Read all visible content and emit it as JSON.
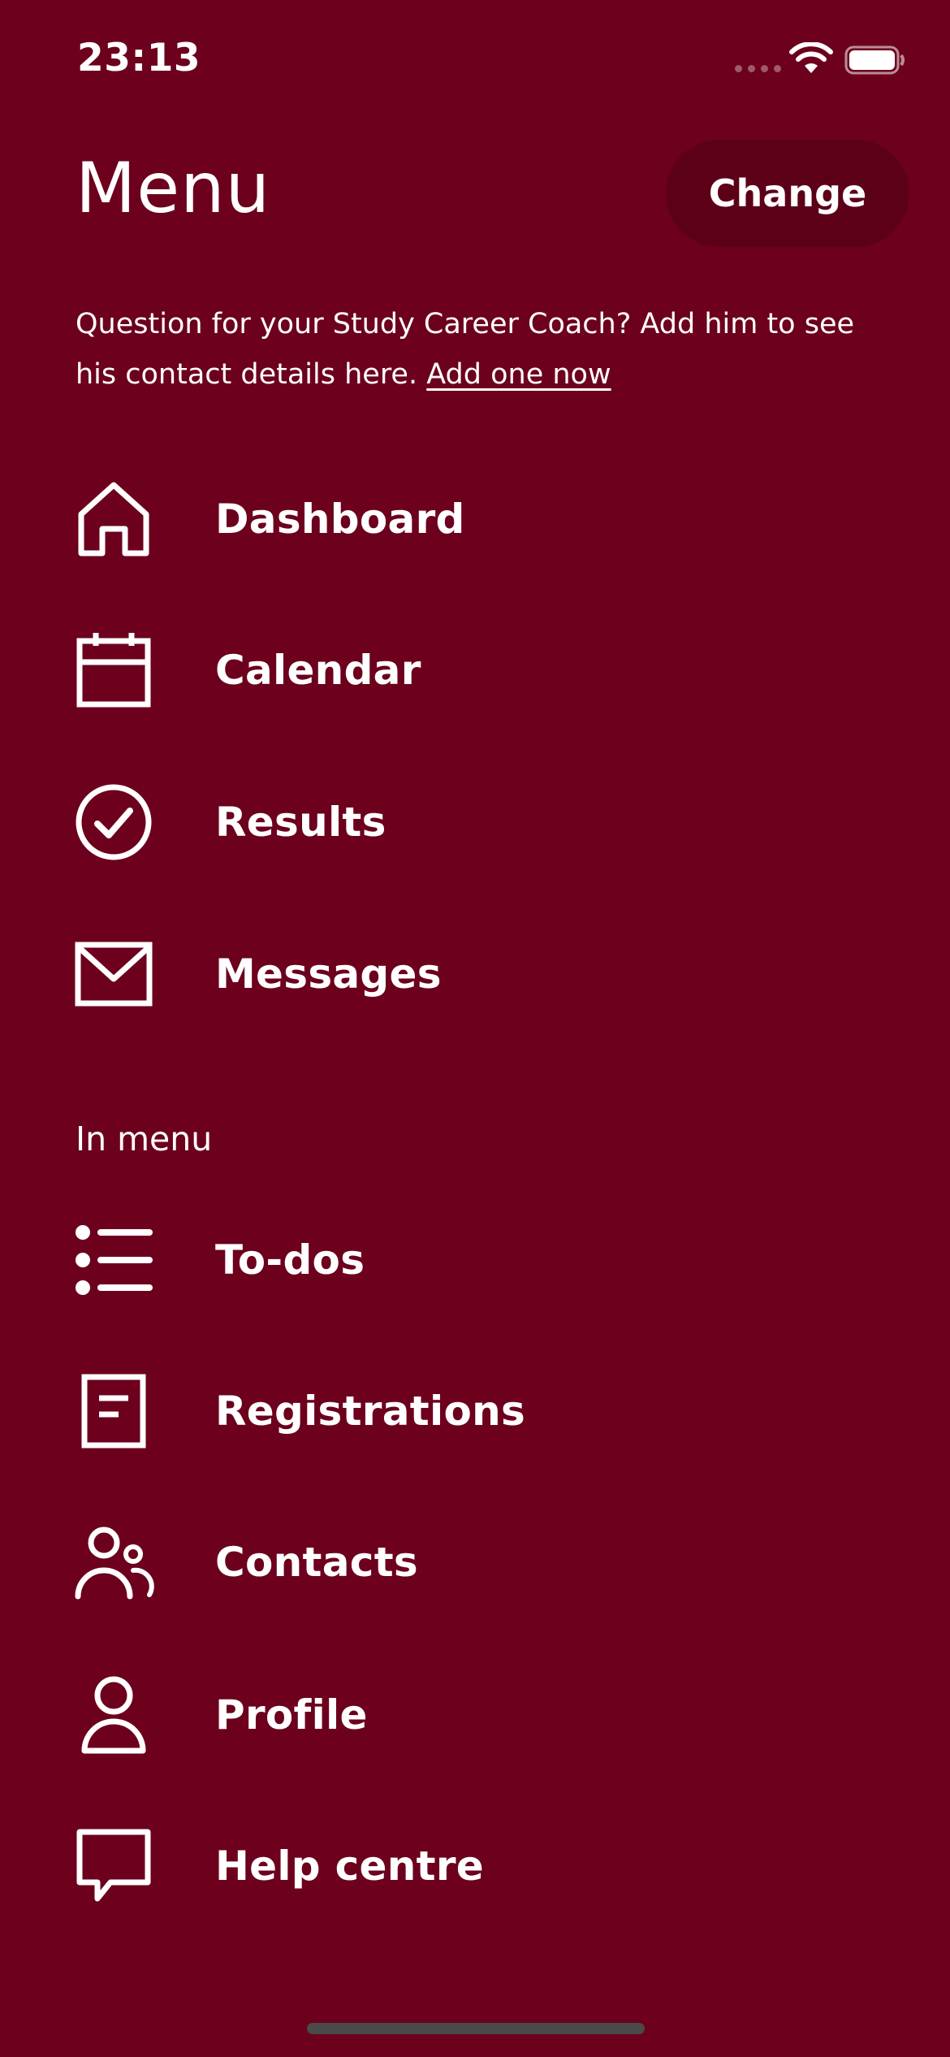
{
  "status_bar": {
    "time": "23:13",
    "wifi_icon": "wifi-icon",
    "battery_icon": "battery-icon"
  },
  "header": {
    "title": "Menu",
    "change_label": "Change"
  },
  "coach_notice": {
    "text": "Question for your Study Career Coach? Add him to see his contact details here.",
    "link_label": "Add one now"
  },
  "main_menu": [
    {
      "label": "Dashboard",
      "icon": "home-icon"
    },
    {
      "label": "Calendar",
      "icon": "calendar-icon"
    },
    {
      "label": "Results",
      "icon": "check-circle-icon"
    },
    {
      "label": "Messages",
      "icon": "mail-icon"
    }
  ],
  "in_menu": {
    "heading": "In menu",
    "items": [
      {
        "label": "To-dos",
        "icon": "list-icon"
      },
      {
        "label": "Registrations",
        "icon": "document-icon"
      },
      {
        "label": "Contacts",
        "icon": "people-icon"
      },
      {
        "label": "Profile",
        "icon": "user-icon"
      },
      {
        "label": "Help centre",
        "icon": "chat-bubble-icon"
      }
    ]
  },
  "colors": {
    "background": "#6c001d",
    "button_background": "#5c0018",
    "text": "#ffffff"
  }
}
